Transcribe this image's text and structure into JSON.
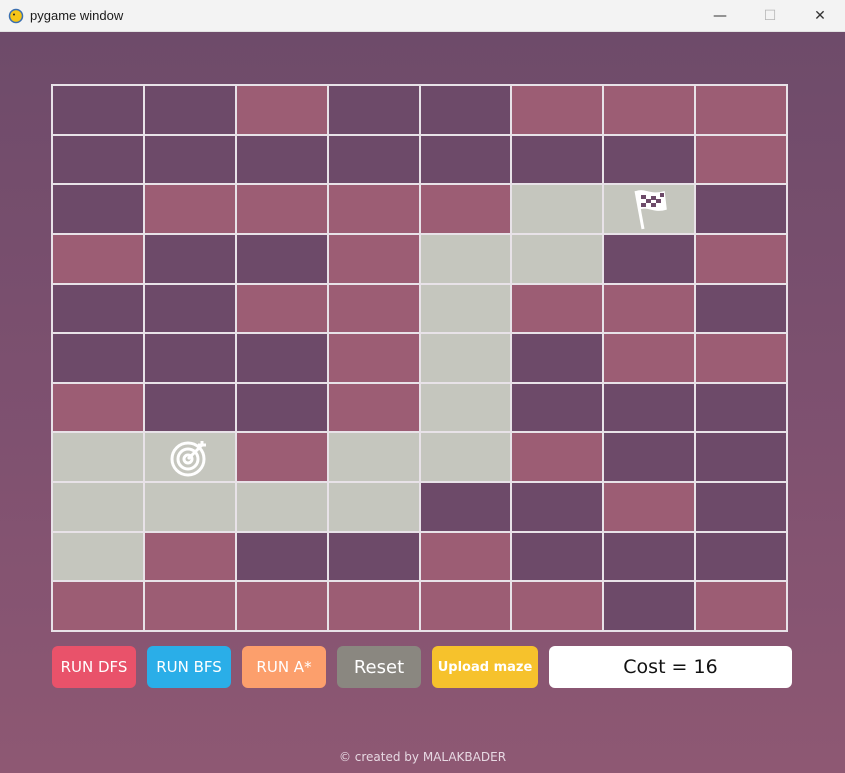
{
  "window": {
    "title": "pygame window",
    "minimize_glyph": "—",
    "maximize_glyph": "☐",
    "close_glyph": "✕"
  },
  "maze": {
    "rows": [
      [
        "dark",
        "dark",
        "rose",
        "dark",
        "dark",
        "rose",
        "rose",
        "rose"
      ],
      [
        "dark",
        "dark",
        "dark",
        "dark",
        "dark",
        "dark",
        "dark",
        "rose"
      ],
      [
        "dark",
        "rose",
        "rose",
        "rose",
        "rose",
        "path",
        "path",
        "dark"
      ],
      [
        "rose",
        "dark",
        "dark",
        "rose",
        "path",
        "path",
        "dark",
        "rose"
      ],
      [
        "dark",
        "dark",
        "rose",
        "rose",
        "path",
        "rose",
        "rose",
        "dark"
      ],
      [
        "dark",
        "dark",
        "dark",
        "rose",
        "path",
        "dark",
        "rose",
        "rose"
      ],
      [
        "rose",
        "dark",
        "dark",
        "rose",
        "path",
        "dark",
        "dark",
        "dark"
      ],
      [
        "path",
        "path",
        "rose",
        "path",
        "path",
        "rose",
        "dark",
        "dark"
      ],
      [
        "path",
        "path",
        "path",
        "path",
        "dark",
        "dark",
        "rose",
        "dark"
      ],
      [
        "path",
        "rose",
        "dark",
        "dark",
        "rose",
        "dark",
        "dark",
        "dark"
      ],
      [
        "rose",
        "rose",
        "rose",
        "rose",
        "rose",
        "rose",
        "dark",
        "rose"
      ]
    ],
    "start_icon": "target-icon",
    "start_cell": [
      7,
      1
    ],
    "goal_icon": "checkered-flag-icon",
    "goal_cell": [
      2,
      6
    ],
    "colors": {
      "dark": "#6d4a69",
      "rose": "#9c5d74",
      "path": "#c5c6be",
      "grid_line": "#e8e2e8"
    }
  },
  "buttons": {
    "dfs": "RUN DFS",
    "bfs": "RUN BFS",
    "astar": "RUN A*",
    "reset": "Reset",
    "upload": "Upload maze"
  },
  "cost": {
    "text": "Cost = 16"
  },
  "footer": {
    "credit": "© created by MALAKBADER"
  }
}
